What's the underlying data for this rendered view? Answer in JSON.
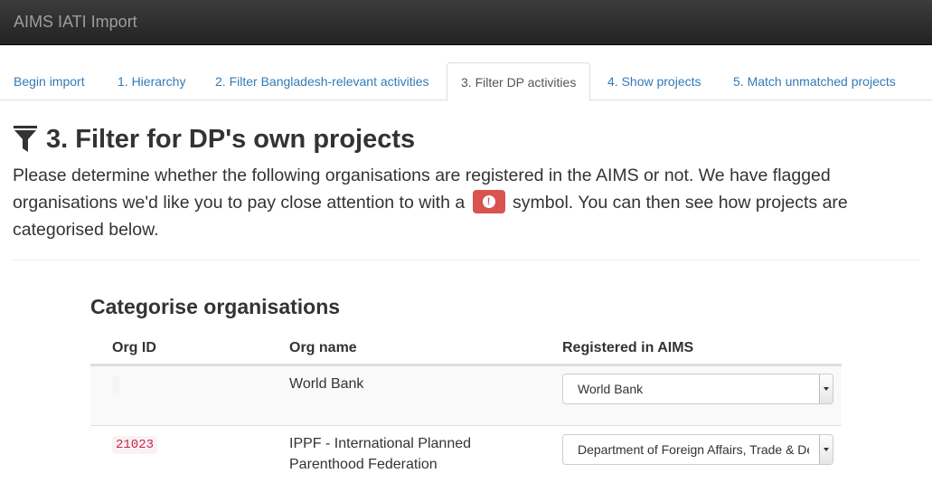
{
  "app": {
    "title": "AIMS IATI Import"
  },
  "tabs": [
    {
      "label": "Begin import",
      "active": false
    },
    {
      "label": "1. Hierarchy",
      "active": false
    },
    {
      "label": "2. Filter Bangladesh-relevant activities",
      "active": false
    },
    {
      "label": "3. Filter DP activities",
      "active": true
    },
    {
      "label": "4. Show projects",
      "active": false
    },
    {
      "label": "5. Match unmatched projects",
      "active": false
    }
  ],
  "page": {
    "title": "3. Filter for DP's own projects",
    "icon": "filter-icon",
    "intro_part1": "Please determine whether the following organisations are registered in the AIMS or not. We have flagged organisations we'd like you to pay close attention to with a",
    "flag_icon": "exclamation-circle-icon",
    "intro_part2": "symbol. You can then see how projects are categorised below."
  },
  "section": {
    "title": "Categorise organisations",
    "columns": [
      "Org ID",
      "Org name",
      "Registered in AIMS"
    ],
    "rows": [
      {
        "org_id": "",
        "org_name": "World Bank",
        "registered": "World Bank"
      },
      {
        "org_id": "21023",
        "org_name": "IPPF - International Planned Parenthood Federation",
        "registered": "Department of Foreign Affairs, Trade & Development"
      }
    ]
  },
  "colors": {
    "navbar": "#222222",
    "link": "#337ab7",
    "danger": "#d9534f",
    "code": "#c7254e"
  }
}
